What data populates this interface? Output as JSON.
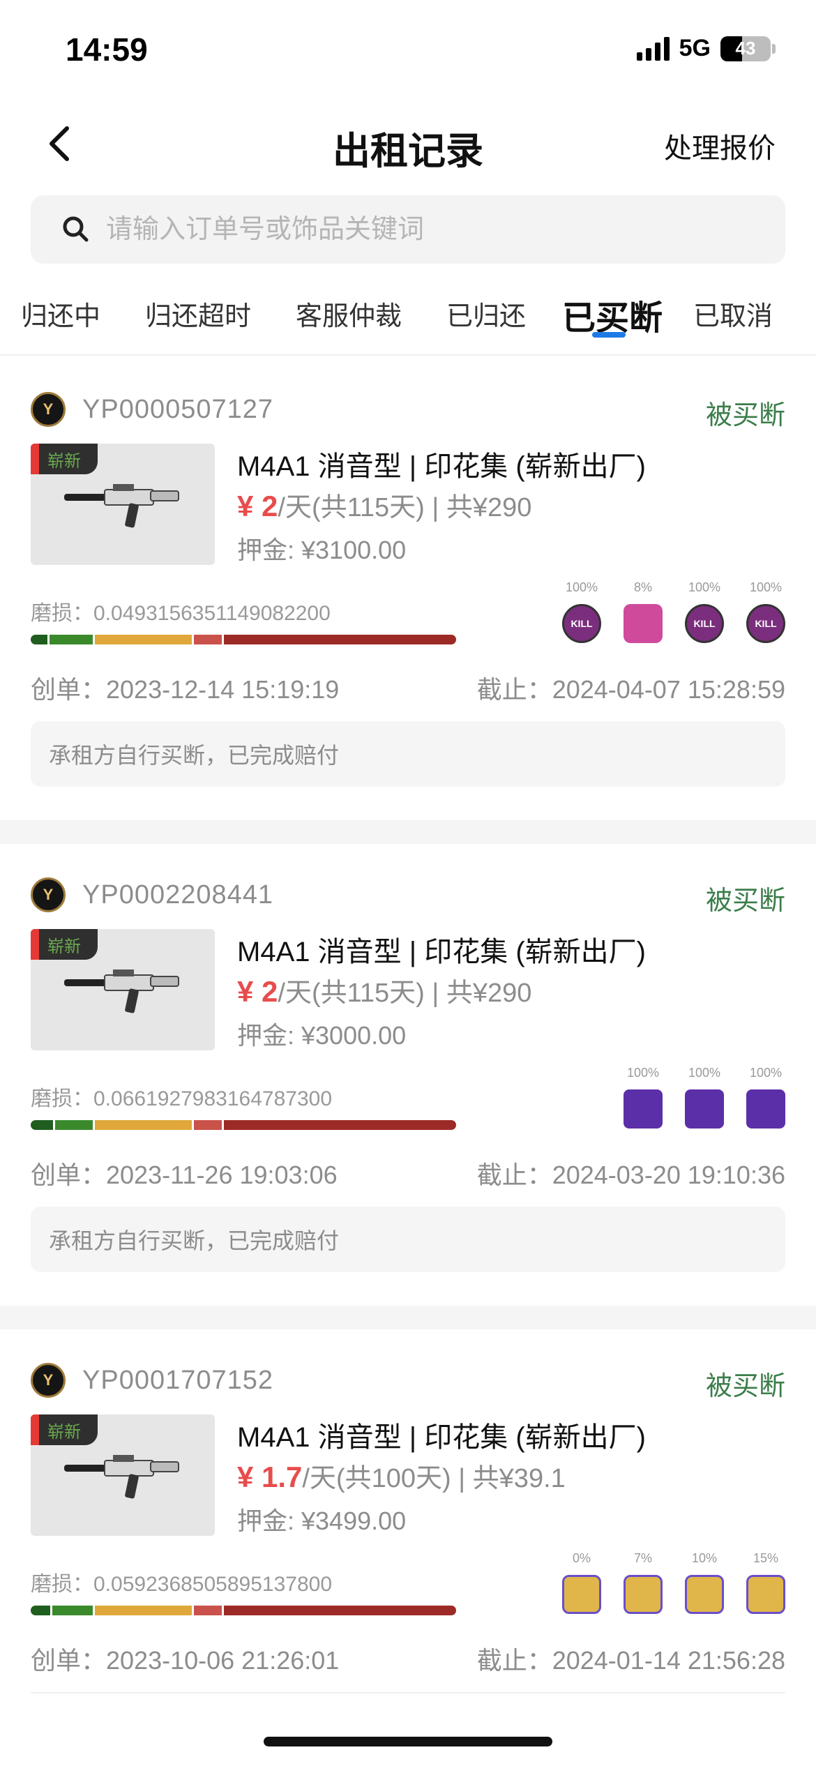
{
  "status_bar": {
    "time": "14:59",
    "network": "5G",
    "battery": "43",
    "battery_level": 0.43
  },
  "nav": {
    "title": "出租记录",
    "action": "处理报价"
  },
  "search": {
    "placeholder": "请输入订单号或饰品关键词",
    "value": ""
  },
  "tabs": [
    {
      "label": "归还中"
    },
    {
      "label": "归还超时"
    },
    {
      "label": "客服仲裁"
    },
    {
      "label": "已归还"
    },
    {
      "label": "已买断",
      "active": true
    },
    {
      "label": "已取消"
    }
  ],
  "orders": [
    {
      "order_no": "YP0000507127",
      "status": "被买断",
      "tag": "崭新",
      "name": "M4A1 消音型 | 印花集 (崭新出厂)",
      "rent": "¥ 2",
      "rent_suffix": "/天(共115天) | 共¥290",
      "deposit": "押金: ¥3100.00",
      "wear": "磨损：0.0493156351149082200",
      "stickers": [
        {
          "pct": "100%",
          "color": "#7b2e7d",
          "label": "KILL"
        },
        {
          "pct": "8%",
          "color": "#d04a9c",
          "label": ""
        },
        {
          "pct": "100%",
          "color": "#7b2e7d",
          "label": "KILL"
        },
        {
          "pct": "100%",
          "color": "#7b2e7d",
          "label": "KILL"
        }
      ],
      "created": "创单：2023-12-14 15:19:19",
      "deadline": "截止：2024-04-07 15:28:59",
      "note": "承租方自行买断，已完成赔付"
    },
    {
      "order_no": "YP0002208441",
      "status": "被买断",
      "tag": "崭新",
      "name": "M4A1 消音型 | 印花集 (崭新出厂)",
      "rent": "¥ 2",
      "rent_suffix": "/天(共115天) | 共¥290",
      "deposit": "押金: ¥3000.00",
      "wear": "磨损：0.0661927983164787300",
      "stickers": [
        {
          "pct": "100%",
          "color": "#5b2fa8",
          "label": ""
        },
        {
          "pct": "100%",
          "color": "#5b2fa8",
          "label": ""
        },
        {
          "pct": "100%",
          "color": "#5b2fa8",
          "label": ""
        }
      ],
      "created": "创单：2023-11-26 19:03:06",
      "deadline": "截止：2024-03-20 19:10:36",
      "note": "承租方自行买断，已完成赔付"
    },
    {
      "order_no": "YP0001707152",
      "status": "被买断",
      "tag": "崭新",
      "name": "M4A1 消音型 | 印花集 (崭新出厂)",
      "rent": "¥ 1.7",
      "rent_suffix": "/天(共100天) | 共¥39.1",
      "deposit": "押金: ¥3499.00",
      "wear": "磨损：0.0592368505895137800",
      "stickers": [
        {
          "pct": "0%",
          "color": "#e0b64a",
          "label": ""
        },
        {
          "pct": "7%",
          "color": "#e0b64a",
          "label": ""
        },
        {
          "pct": "10%",
          "color": "#e0b64a",
          "label": ""
        },
        {
          "pct": "15%",
          "color": "#e0b64a",
          "label": ""
        }
      ],
      "created": "创单：2023-10-06 21:26:01",
      "deadline": "截止：2024-01-14 21:56:28",
      "note": ""
    }
  ],
  "colors": {
    "accent_blue": "#1e7be6",
    "status_green": "#3b7d4a",
    "price_red": "#e84c4c",
    "wear_dark_green": "#1f5e1f",
    "wear_green": "#3a8a2c",
    "wear_yellow": "#e0a83a",
    "wear_light_red": "#c9524b",
    "wear_dark_red": "#9c2a26"
  }
}
